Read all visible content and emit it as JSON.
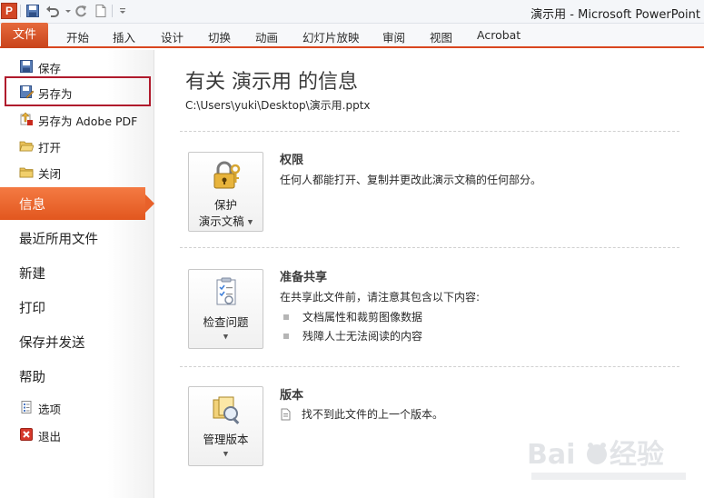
{
  "window": {
    "title": "演示用 - Microsoft PowerPoint",
    "app_icon_letter": "P"
  },
  "colors": {
    "accent": "#d9461f",
    "active_nav": "#e8612a",
    "highlight_box": "#b01a2c"
  },
  "ribbon": {
    "file_tab": "文件",
    "tabs": [
      "开始",
      "插入",
      "设计",
      "切换",
      "动画",
      "幻灯片放映",
      "审阅",
      "视图",
      "Acrobat"
    ]
  },
  "backstage": {
    "commands": [
      {
        "label": "保存",
        "icon": "save-icon"
      },
      {
        "label": "另存为",
        "icon": "save-as-icon"
      },
      {
        "label": "另存为 Adobe PDF",
        "icon": "pdf-icon"
      },
      {
        "label": "打开",
        "icon": "open-folder-icon"
      },
      {
        "label": "关闭",
        "icon": "close-folder-icon"
      }
    ],
    "nav": [
      "信息",
      "最近所用文件",
      "新建",
      "打印",
      "保存并发送",
      "帮助"
    ],
    "active_nav": "信息",
    "bottom_commands": [
      {
        "label": "选项",
        "icon": "options-icon"
      },
      {
        "label": "退出",
        "icon": "exit-icon"
      }
    ]
  },
  "info": {
    "title": "有关 演示用 的信息",
    "path": "C:\\Users\\yuki\\Desktop\\演示用.pptx",
    "sections": [
      {
        "button_line1": "保护",
        "button_line2": "演示文稿",
        "title": "权限",
        "desc": "任何人都能打开、复制并更改此演示文稿的任何部分。"
      },
      {
        "button_line1": "检查问题",
        "title": "准备共享",
        "desc": "在共享此文件前，请注意其包含以下内容:",
        "bullets": [
          "文档属性和裁剪图像数据",
          "残障人士无法阅读的内容"
        ]
      },
      {
        "button_line1": "管理版本",
        "title": "版本",
        "desc": "找不到此文件的上一个版本。"
      }
    ]
  }
}
